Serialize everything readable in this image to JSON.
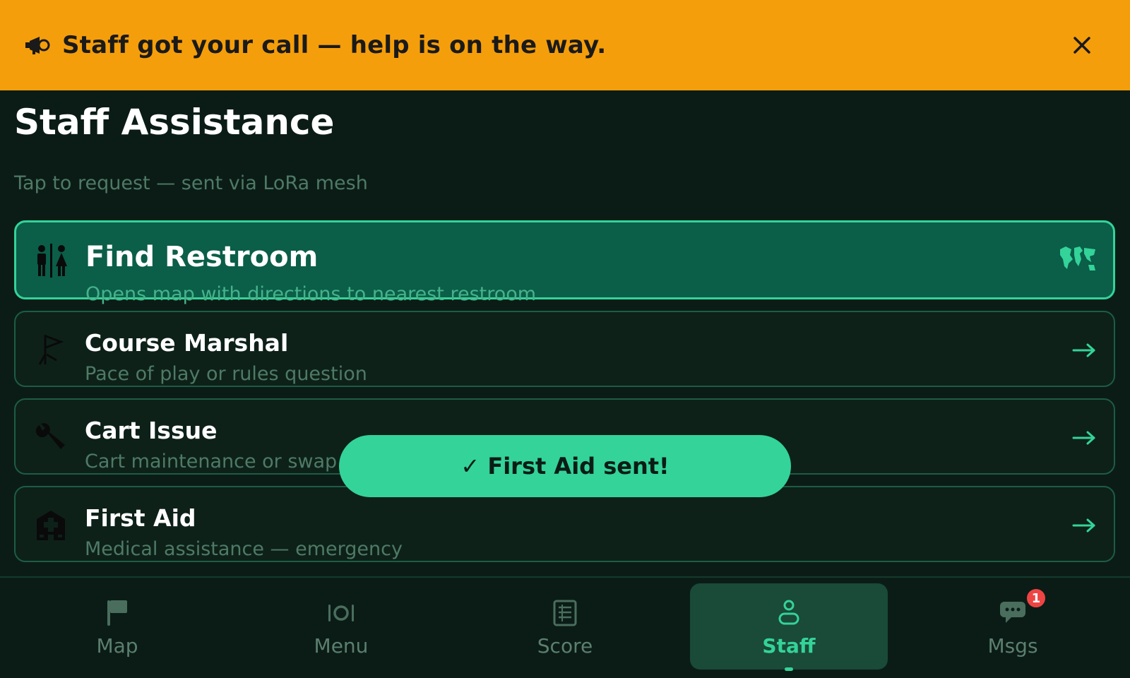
{
  "banner": {
    "icon": "megaphone-icon",
    "message": "Staff got your call — help is on the way.",
    "close_icon": "close-icon",
    "color": "#f59e0b"
  },
  "page": {
    "title": "Staff Assistance",
    "subtitle": "Tap to request — sent via LoRa mesh"
  },
  "options": [
    {
      "icon": "restroom-icon",
      "title": "Find Restroom",
      "description": "Opens map with directions to nearest restroom",
      "trailing_icon": "world-map-icon",
      "active": true
    },
    {
      "icon": "golf-flag-icon",
      "title": "Course Marshal",
      "description": "Pace of play or rules question",
      "trailing_icon": "arrow-right-icon",
      "active": false
    },
    {
      "icon": "wrench-icon",
      "title": "Cart Issue",
      "description": "Cart maintenance or swap needed",
      "trailing_icon": "arrow-right-icon",
      "active": false
    },
    {
      "icon": "hospital-icon",
      "title": "First Aid",
      "description": "Medical assistance — emergency",
      "trailing_icon": "arrow-right-icon",
      "active": false
    }
  ],
  "toast": {
    "message": "✓ First Aid sent!"
  },
  "nav": {
    "items": [
      {
        "label": "Map",
        "icon": "flag-icon",
        "active": false
      },
      {
        "label": "Menu",
        "icon": "dining-icon",
        "active": false
      },
      {
        "label": "Score",
        "icon": "scorecard-icon",
        "active": false
      },
      {
        "label": "Staff",
        "icon": "staff-person-icon",
        "active": true
      },
      {
        "label": "Msgs",
        "icon": "chat-icon",
        "active": false,
        "badge": "1"
      }
    ]
  },
  "colors": {
    "background": "#0b1c16",
    "accent": "#34d399",
    "badge": "#ef4444",
    "muted_text": "#4e7a66"
  }
}
